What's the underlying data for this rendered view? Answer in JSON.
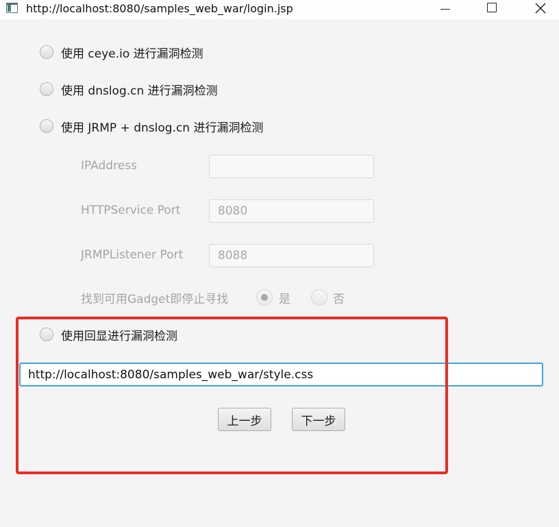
{
  "window": {
    "title": "http://localhost:8080/samples_web_war/login.jsp",
    "controls": {
      "minimize": "minimize-icon",
      "maximize": "maximize-icon",
      "close": "close-icon"
    }
  },
  "options": [
    {
      "label": "使用 ceye.io 进行漏洞检测",
      "selected": false
    },
    {
      "label": "使用 dnslog.cn 进行漏洞检测",
      "selected": false
    },
    {
      "label": "使用 JRMP + dnslog.cn 进行漏洞检测",
      "selected": false
    },
    {
      "label": "使用回显进行漏洞检测",
      "selected": false
    }
  ],
  "jrmp_form": {
    "ip_label": "IPAddress",
    "ip_value": "",
    "http_port_label": "HTTPService Port",
    "http_port_value": "8080",
    "jrmp_port_label": "JRMPListener Port",
    "jrmp_port_value": "8088",
    "stop_label": "找到可用Gadget即停止寻找",
    "yes_label": "是",
    "no_label": "否",
    "stop_selected": "是"
  },
  "url_field": {
    "value": "http://localhost:8080/samples_web_war/style.css"
  },
  "buttons": {
    "prev": "上一步",
    "next": "下一步"
  },
  "colors": {
    "highlight": "#ee2a24",
    "focus_border": "#3aa4e0"
  }
}
